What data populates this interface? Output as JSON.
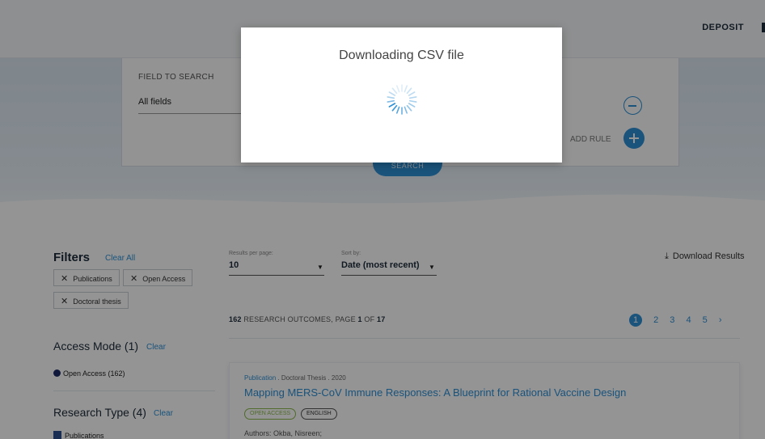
{
  "header": {
    "deposit_label": "DEPOSIT"
  },
  "search": {
    "field_label": "FIELD TO SEARCH",
    "field_value": "All fields",
    "add_rule_label": "ADD RULE",
    "search_button": "SEARCH"
  },
  "filters": {
    "title": "Filters",
    "clear_all": "Clear All",
    "chips": [
      "Publications",
      "Open Access",
      "Doctoral thesis"
    ],
    "access_mode": {
      "title": "Access Mode (1)",
      "clear": "Clear",
      "items": [
        "Open Access (162)"
      ]
    },
    "research_type": {
      "title": "Research Type (4)",
      "clear": "Clear",
      "items": [
        "Publications"
      ]
    }
  },
  "results": {
    "per_page_label": "Results per page:",
    "per_page_value": "10",
    "sort_label": "Sort by:",
    "sort_value": "Date (most recent)",
    "download_label": "Download Results",
    "count_prefix": "RESEARCH OUTCOMES, PAGE",
    "count_total": "162",
    "page_current": "1",
    "of_label": "OF",
    "page_total": "17",
    "pages": [
      "1",
      "2",
      "3",
      "4",
      "5"
    ],
    "next": "›",
    "item": {
      "type": "Publication",
      "meta": ". Doctoral Thesis . 2020",
      "title": "Mapping MERS-CoV Immune Responses: A Blueprint for Rational Vaccine Design",
      "badges": [
        "OPEN ACCESS",
        "ENGLISH"
      ],
      "authors": "Authors: Okba, Nisreen;"
    }
  },
  "modal": {
    "title": "Downloading CSV file"
  },
  "colors": {
    "accent": "#2d8fd5",
    "overlay": "rgba(0,0,0,0.42)",
    "open_access": "#8bb94a"
  },
  "icons": {
    "close": "close-icon",
    "download": "download-icon",
    "spinner": "spinner-icon",
    "next": "chevron-right-icon"
  }
}
